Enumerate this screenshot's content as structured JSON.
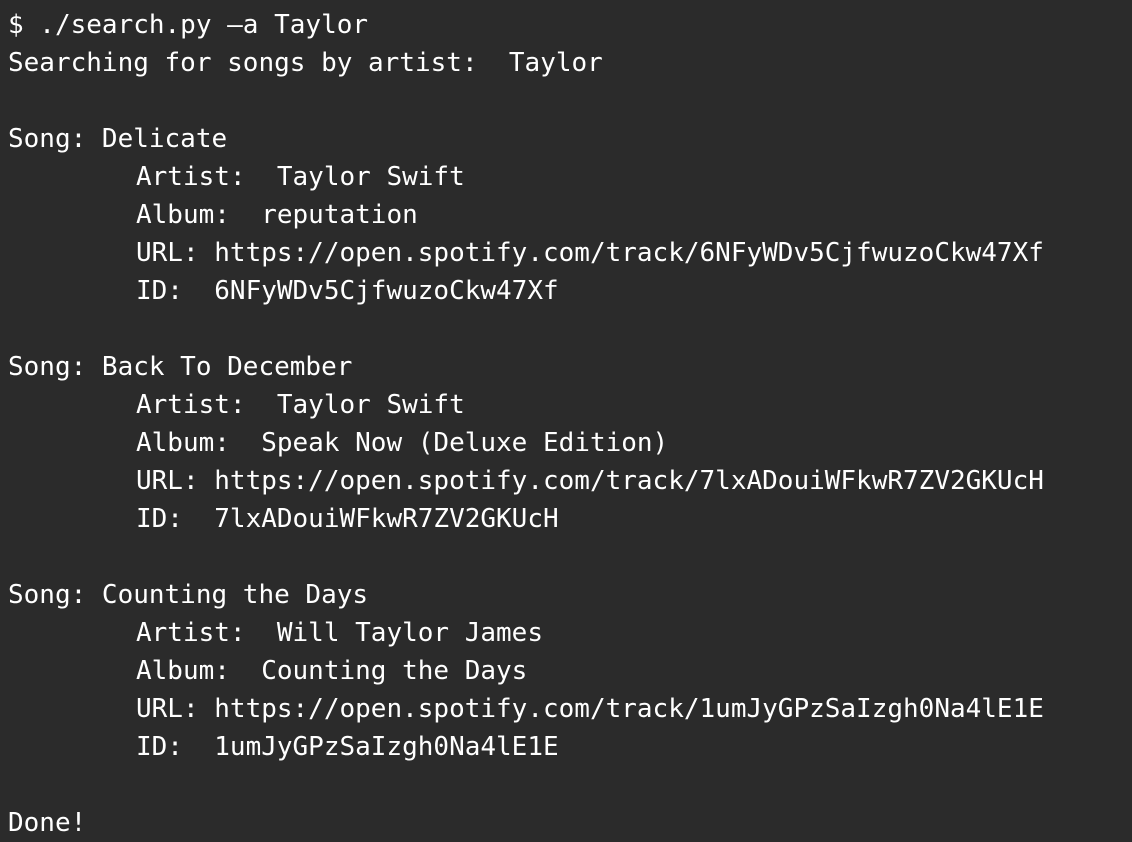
{
  "terminal": {
    "bg_color": "#2b2b2b",
    "text_color": "#ffffff",
    "command": "$ ./search.py –a Taylor",
    "searching": "Searching for songs by artist:  Taylor",
    "results": [
      {
        "song": "Song: Delicate",
        "artist": "Artist:  Taylor Swift",
        "album": "Album:  reputation",
        "url": "URL: https://open.spotify.com/track/6NFyWDv5CjfwuzoCkw47Xf",
        "id": "ID:  6NFyWDv5CjfwuzoCkw47Xf"
      },
      {
        "song": "Song: Back To December",
        "artist": "Artist:  Taylor Swift",
        "album": "Album:  Speak Now (Deluxe Edition)",
        "url": "URL: https://open.spotify.com/track/7lxADouiWFkwR7ZV2GKUcH",
        "id": "ID:  7lxADouiWFkwR7ZV2GKUcH"
      },
      {
        "song": "Song: Counting the Days",
        "artist": "Artist:  Will Taylor James",
        "album": "Album:  Counting the Days",
        "url": "URL: https://open.spotify.com/track/1umJyGPzSaIzgh0Na4lE1E",
        "id": "ID:  1umJyGPzSaIzgh0Na4lE1E"
      }
    ],
    "done": "Done!"
  }
}
